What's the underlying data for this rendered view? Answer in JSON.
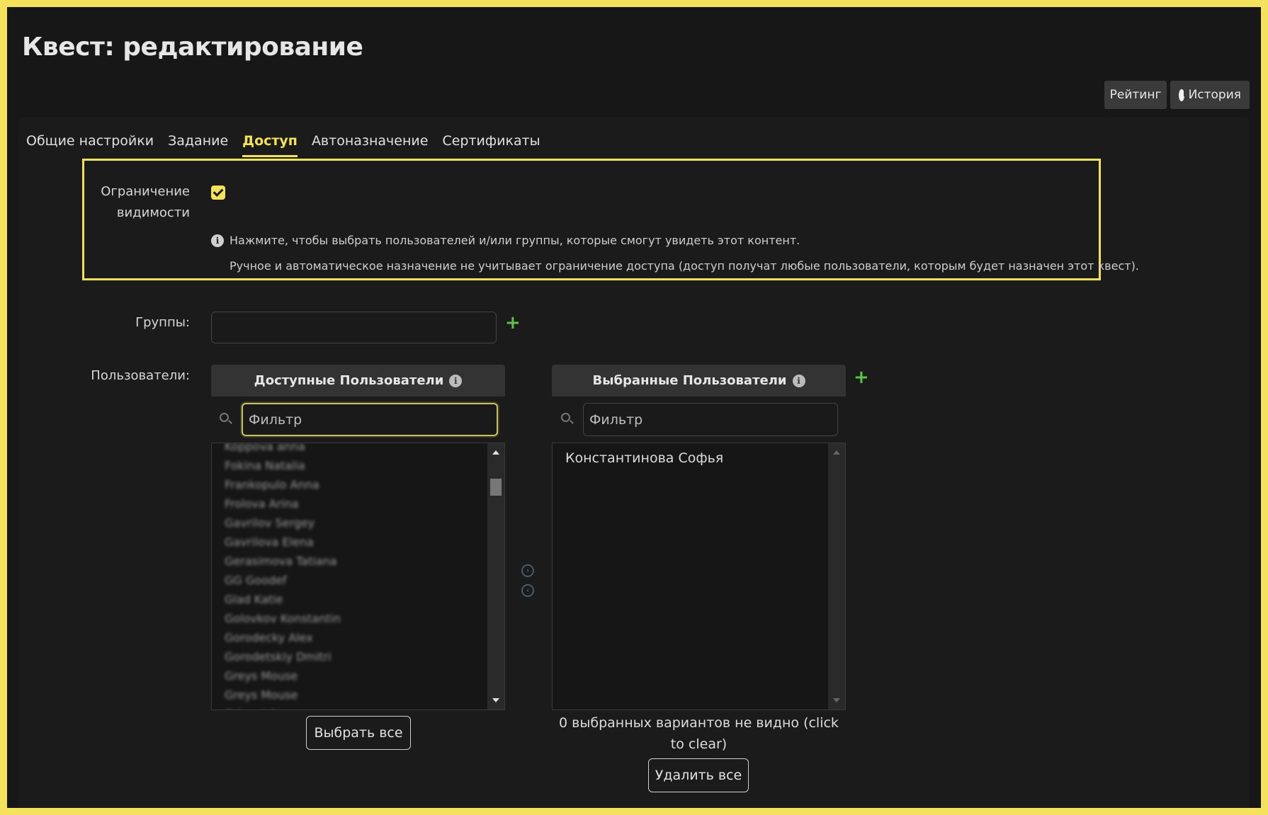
{
  "page": {
    "title": "Квест: редактирование"
  },
  "toolbar": {
    "rating_label": "Рейтинг",
    "history_label": "История"
  },
  "tabs": [
    {
      "label": "Общие настройки",
      "active": false
    },
    {
      "label": "Задание",
      "active": false
    },
    {
      "label": "Доступ",
      "active": true
    },
    {
      "label": "Автоназначение",
      "active": false
    },
    {
      "label": "Сертификаты",
      "active": false
    }
  ],
  "visibility": {
    "label_line1": "Ограничение",
    "label_line2": "видимости",
    "checked": true,
    "hint1": "Нажмите, чтобы выбрать пользователей и/или группы, которые смогут увидеть этот контент.",
    "hint2": "Ручное и автоматическое назначение не учитывает ограничение доступа (доступ получат любые пользователи, которым будет назначен этот квест)."
  },
  "groups": {
    "label": "Группы:",
    "value": ""
  },
  "users": {
    "label": "Пользователи:",
    "available": {
      "header": "Доступные Пользователи",
      "filter_placeholder": "Фильтр",
      "items": [
        "Koppova anna",
        "Fokina Natalia",
        "Frankopulo Anna",
        "Frolova Arina",
        "Gavrilov Sergey",
        "Gavrilova Elena",
        "Gerasimova Tatiana",
        "GG Goodef",
        "Glad Katie",
        "Golovkov Konstantin",
        "Gorodecky Alex",
        "Gorodetskiy Dmitri",
        "Greys Mouse",
        "Greys Mouse",
        "Grinevich"
      ],
      "select_all_label": "Выбрать все"
    },
    "selected": {
      "header": "Выбранные Пользователи",
      "filter_placeholder": "Фильтр",
      "items": [
        "Константинова Софья"
      ],
      "hidden_note": "0 выбранных вариантов не видно (click to clear)",
      "delete_all_label": "Удалить все"
    }
  },
  "colors": {
    "accent": "#f4e25c",
    "add": "#5ec24a",
    "background": "#171717"
  },
  "icons": [
    "clock-icon",
    "checkbox-icon",
    "info-icon",
    "plus-icon",
    "search-icon",
    "arrow-right-icon",
    "arrow-left-icon"
  ]
}
